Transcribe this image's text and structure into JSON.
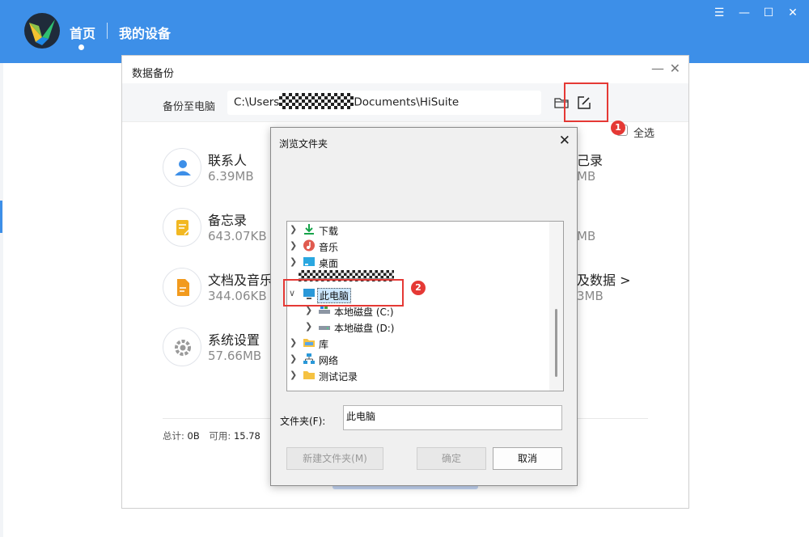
{
  "app": {
    "nav": {
      "home": "首页",
      "devices": "我的设备"
    },
    "window_controls": {
      "menu": "☰",
      "minimize": "—",
      "maximize": "☐",
      "close": "✕"
    },
    "colors": {
      "accent": "#3d8fe8",
      "highlight": "#e53935"
    }
  },
  "backup_dialog": {
    "title": "数据备份",
    "minimize": "—",
    "close": "✕",
    "backup_to_label": "备份至电脑",
    "path_prefix": "C:\\Users",
    "path_suffix": "Documents\\HiSuite",
    "select_all": "全选",
    "annotation_1": "1",
    "categories": [
      {
        "name": "联系人",
        "size": "6.39MB",
        "icon": "contact-icon"
      },
      {
        "name": "备忘录",
        "size": "643.07KB",
        "icon": "memo-icon"
      },
      {
        "name": "文档及音乐",
        "size": "344.06KB",
        "icon": "document-icon"
      },
      {
        "name": "系统设置",
        "size": "57.66MB",
        "icon": "gear-icon"
      }
    ],
    "right_fragments": [
      {
        "text": "己录"
      },
      {
        "text": "MB"
      },
      {
        "text": "MB"
      },
      {
        "text": "及数据 >"
      },
      {
        "text": "3MB"
      }
    ],
    "storage": {
      "total_label": "总计:",
      "total_value": "0B",
      "available_label": "可用:",
      "available_value": "15.78"
    }
  },
  "browse_dialog": {
    "title": "浏览文件夹",
    "close": "✕",
    "tree": [
      {
        "label": "下载",
        "icon": "download-icon",
        "level": 0,
        "expanded": false
      },
      {
        "label": "音乐",
        "icon": "music-icon",
        "level": 0,
        "expanded": false
      },
      {
        "label": "桌面",
        "icon": "desktop-icon",
        "level": 0,
        "expanded": false
      },
      {
        "label": "此电脑",
        "icon": "computer-icon",
        "level": 0,
        "expanded": true,
        "selected": true
      },
      {
        "label": "本地磁盘 (C:)",
        "icon": "drive-icon",
        "level": 1,
        "expanded": false
      },
      {
        "label": "本地磁盘 (D:)",
        "icon": "drive-icon",
        "level": 1,
        "expanded": false
      },
      {
        "label": "库",
        "icon": "folder-icon",
        "level": 0,
        "expanded": false
      },
      {
        "label": "网络",
        "icon": "network-icon",
        "level": 0,
        "expanded": false
      },
      {
        "label": "测试记录",
        "icon": "folder-icon",
        "level": 0,
        "expanded": false
      }
    ],
    "annotation_2": "2",
    "folder_label": "文件夹(F):",
    "folder_value": "此电脑",
    "buttons": {
      "new_folder": "新建文件夹(M)",
      "ok": "确定",
      "cancel": "取消"
    }
  }
}
